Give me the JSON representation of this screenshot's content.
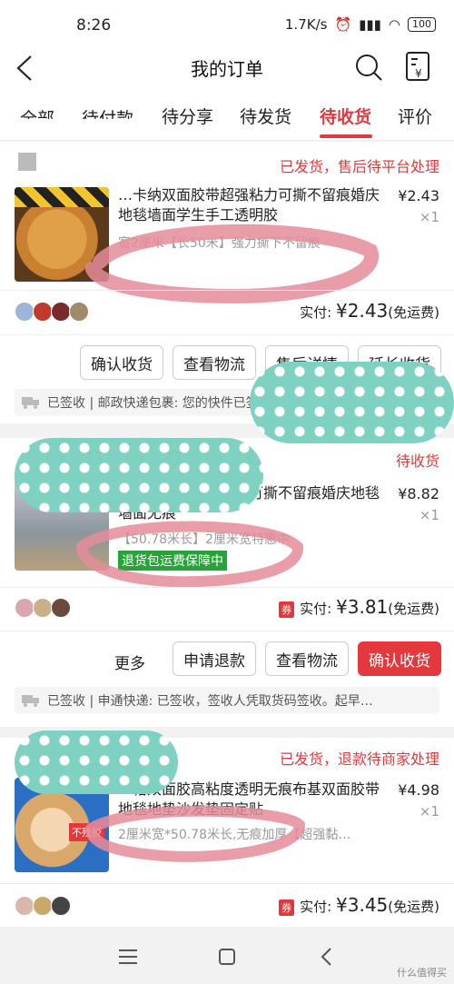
{
  "status_bar": {
    "time": "8:26",
    "speed": "1.7K/s",
    "battery": "100"
  },
  "nav": {
    "title": "我的订单"
  },
  "tabs": [
    {
      "label": "全部"
    },
    {
      "label": "待付款"
    },
    {
      "label": "待分享"
    },
    {
      "label": "待发货"
    },
    {
      "label": "待收货"
    },
    {
      "label": "评价"
    }
  ],
  "orders": [
    {
      "status": "已发货，售后待平台处理",
      "title": "…卡纳双面胶带超强粘力可撕不留痕婚庆地毯墙面学生手工透明胶",
      "spec": "宽2厘米【长50米】强力撕下不留痕",
      "price": "¥2.43",
      "qty": "×1",
      "paid_label": "实付:",
      "paid_amount": "¥2.43",
      "shipping": "(免运费)",
      "buttons": [
        "确认收货",
        "查看物流",
        "售后详情",
        "延长收货"
      ],
      "logistics": "已签收 | 邮政快递包裹: 您的快件已签收…"
    },
    {
      "status": "待收货",
      "title": "…双面胶带超强粘力可撕不留痕婚庆地毯墙面无痕",
      "spec": "【50.78米长】2厘米宽特惠中",
      "tag": "退货包运费保障中",
      "price": "¥8.82",
      "qty": "×1",
      "coupon": "券",
      "paid_label": "实付:",
      "paid_amount": "¥3.81",
      "shipping": "(免运费)",
      "more": "更多",
      "buttons": [
        "申请退款",
        "查看物流",
        "确认收货"
      ],
      "logistics": "已签收 | 申通快递: 已签收，签收人凭取货码签收。起早…"
    },
    {
      "status": "已发货，退款待商家处理",
      "title": "…格双面胶高粘度透明无痕布基双面胶带地毯地垫沙发垫固定贴",
      "spec": "2厘米宽*50.78米长,无痕加厚【超强黏…",
      "thumb_tag": "不残胶",
      "price": "¥4.98",
      "qty": "×1",
      "coupon": "券",
      "paid_label": "实付:",
      "paid_amount": "¥3.45",
      "shipping": "(免运费)"
    }
  ],
  "watermark": "什么值得买"
}
